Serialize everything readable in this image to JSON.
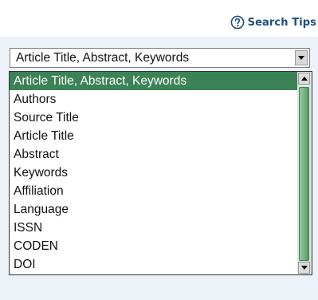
{
  "header": {
    "search_tips_label": "Search Tips",
    "help_icon": "question-circle-icon"
  },
  "field_select": {
    "selected_value": "Article Title, Abstract, Keywords",
    "options": [
      "Article Title, Abstract, Keywords",
      "Authors",
      "Source Title",
      "Article Title",
      "Abstract",
      "Keywords",
      "Affiliation",
      "Language",
      "ISSN",
      "CODEN",
      "DOI"
    ],
    "highlighted_index": 0
  },
  "colors": {
    "highlight": "#3c8257",
    "link": "#1d4f80",
    "scroll_thumb": "#4f9f62"
  }
}
